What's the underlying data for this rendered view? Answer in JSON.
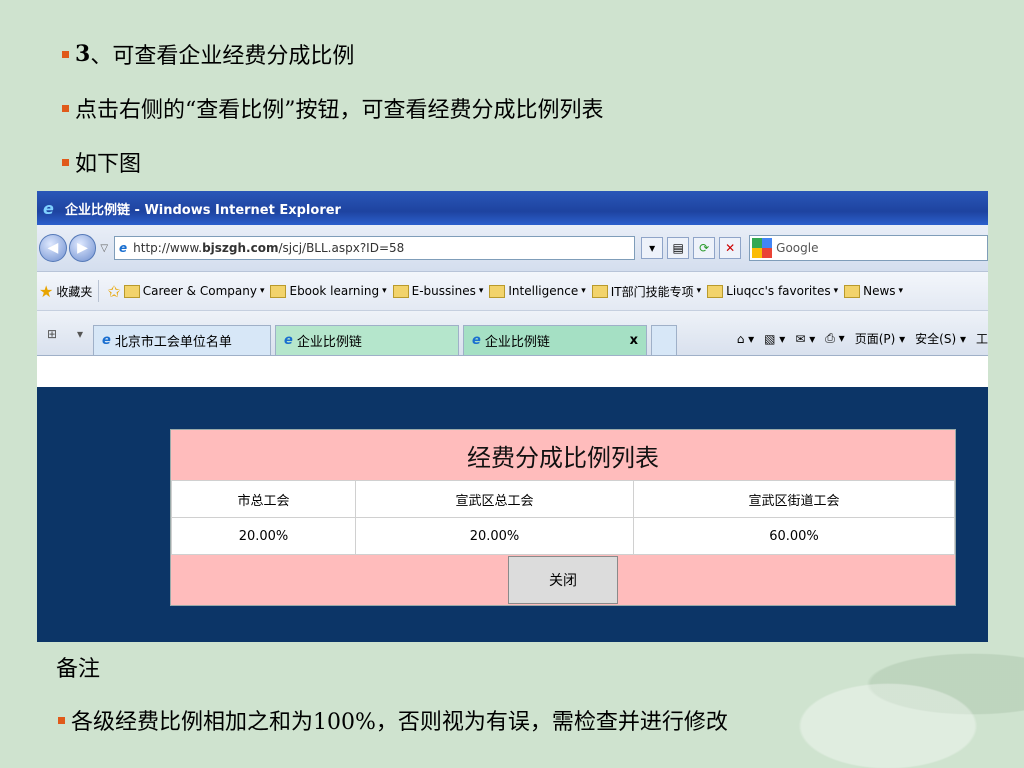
{
  "slide": {
    "line1_num": "3",
    "line1_text": "、可查看企业经费分成比例",
    "line2": "点击右侧的“查看比例”按钮，可查看经费分成比例列表",
    "line3": "如下图",
    "notes_title": "备注",
    "line4": "各级经费比例相加之和为100%，否则视为有误，需检查并进行修改",
    "bullet_color": "#e05a1a"
  },
  "browser": {
    "title": "企业比例链 - Windows Internet Explorer",
    "address_prefix": "http://www.",
    "address_domain": "bjszgh.com",
    "address_rest": "/sjcj/BLL.aspx?ID=58",
    "search_placeholder": "Google",
    "favorites_label": "收藏夹",
    "favorites": [
      "Career & Company",
      "Ebook learning",
      "E-bussines",
      "Intelligence",
      "IT部门技能专项",
      "Liuqcc's favorites",
      "News"
    ],
    "tabs": [
      {
        "label": "北京市工会单位名单"
      },
      {
        "label": "企业比例链"
      },
      {
        "label": "企业比例链"
      }
    ],
    "tab_close": "x",
    "commands": [
      "页面(P)",
      "安全(S)",
      "工"
    ]
  },
  "page": {
    "table_title": "经费分成比例列表",
    "headers": [
      "市总工会",
      "宣武区总工会",
      "宣武区街道工会"
    ],
    "values": [
      "20.00%",
      "20.00%",
      "60.00%"
    ],
    "close_button": "关闭"
  }
}
